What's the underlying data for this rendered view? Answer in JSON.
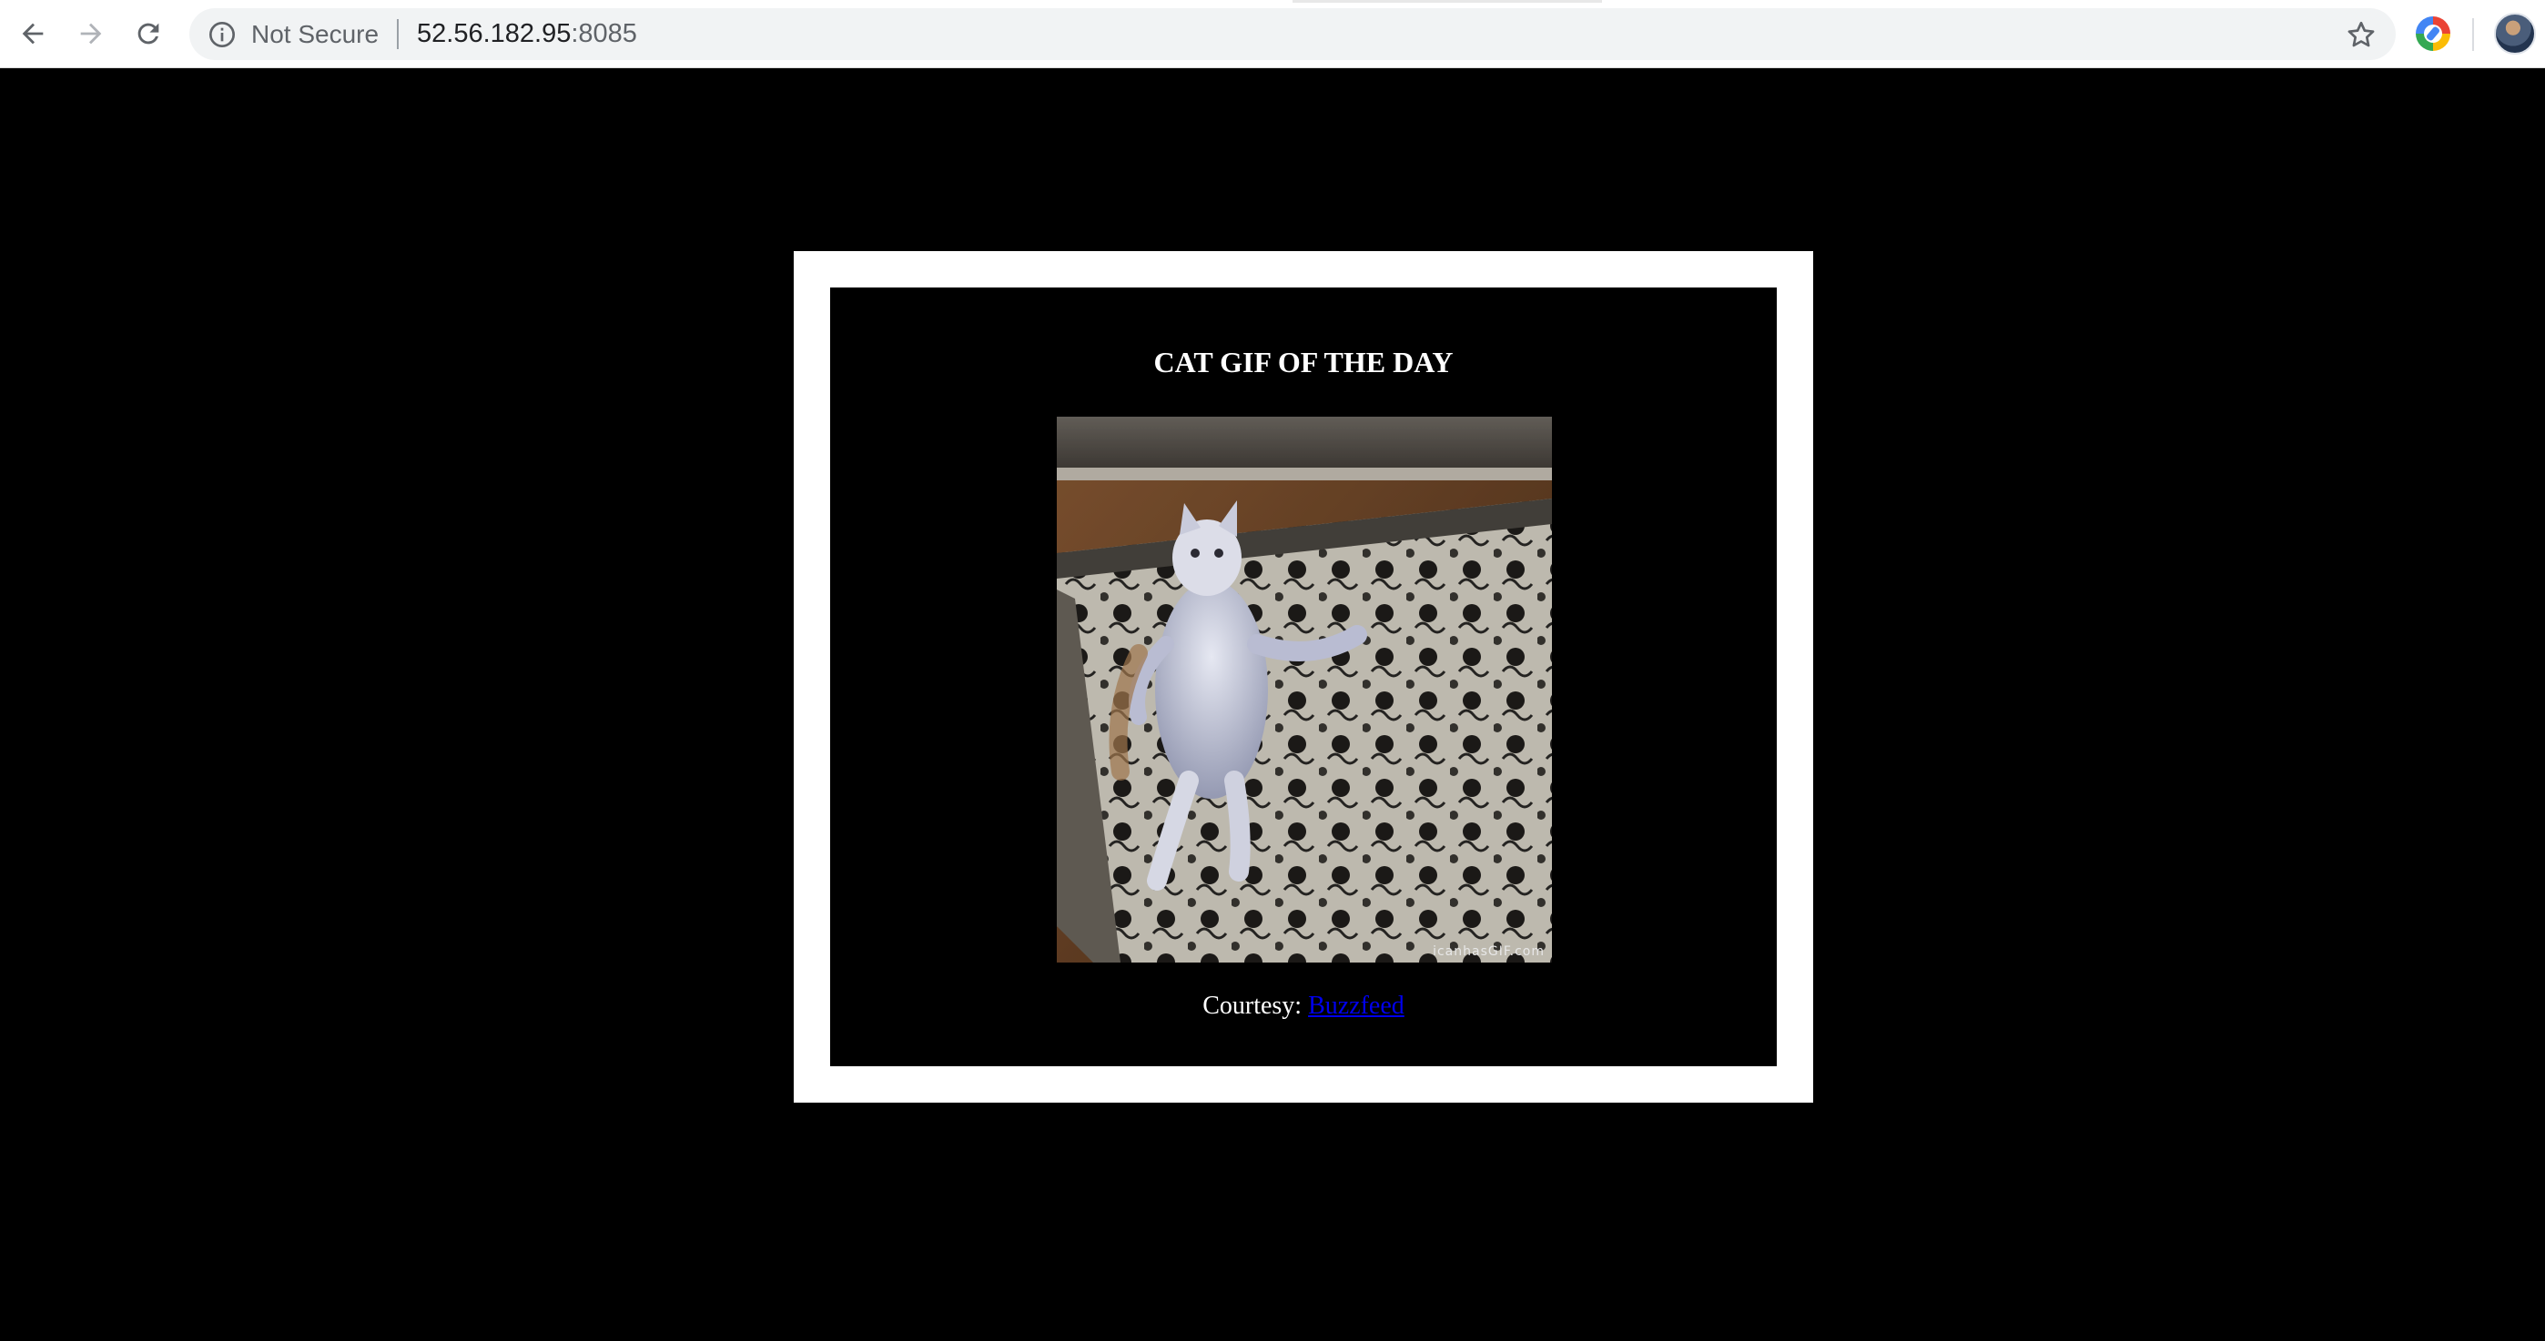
{
  "browser": {
    "security_label": "Not Secure",
    "url_host": "52.56.182.95",
    "url_port": ":8085",
    "icons": {
      "back": "back-arrow-icon",
      "forward": "forward-arrow-icon",
      "reload": "reload-icon",
      "info": "info-icon",
      "bookmark": "star-icon",
      "extension": "extension-icon",
      "profile": "avatar"
    }
  },
  "page": {
    "title": "CAT GIF OF THE DAY",
    "image_watermark": "icanhasGIF.com",
    "courtesy_label": "Courtesy:",
    "courtesy_link": "Buzzfeed",
    "colors": {
      "background": "#000000",
      "frame": "#ffffff",
      "link": "#0000ee"
    }
  }
}
